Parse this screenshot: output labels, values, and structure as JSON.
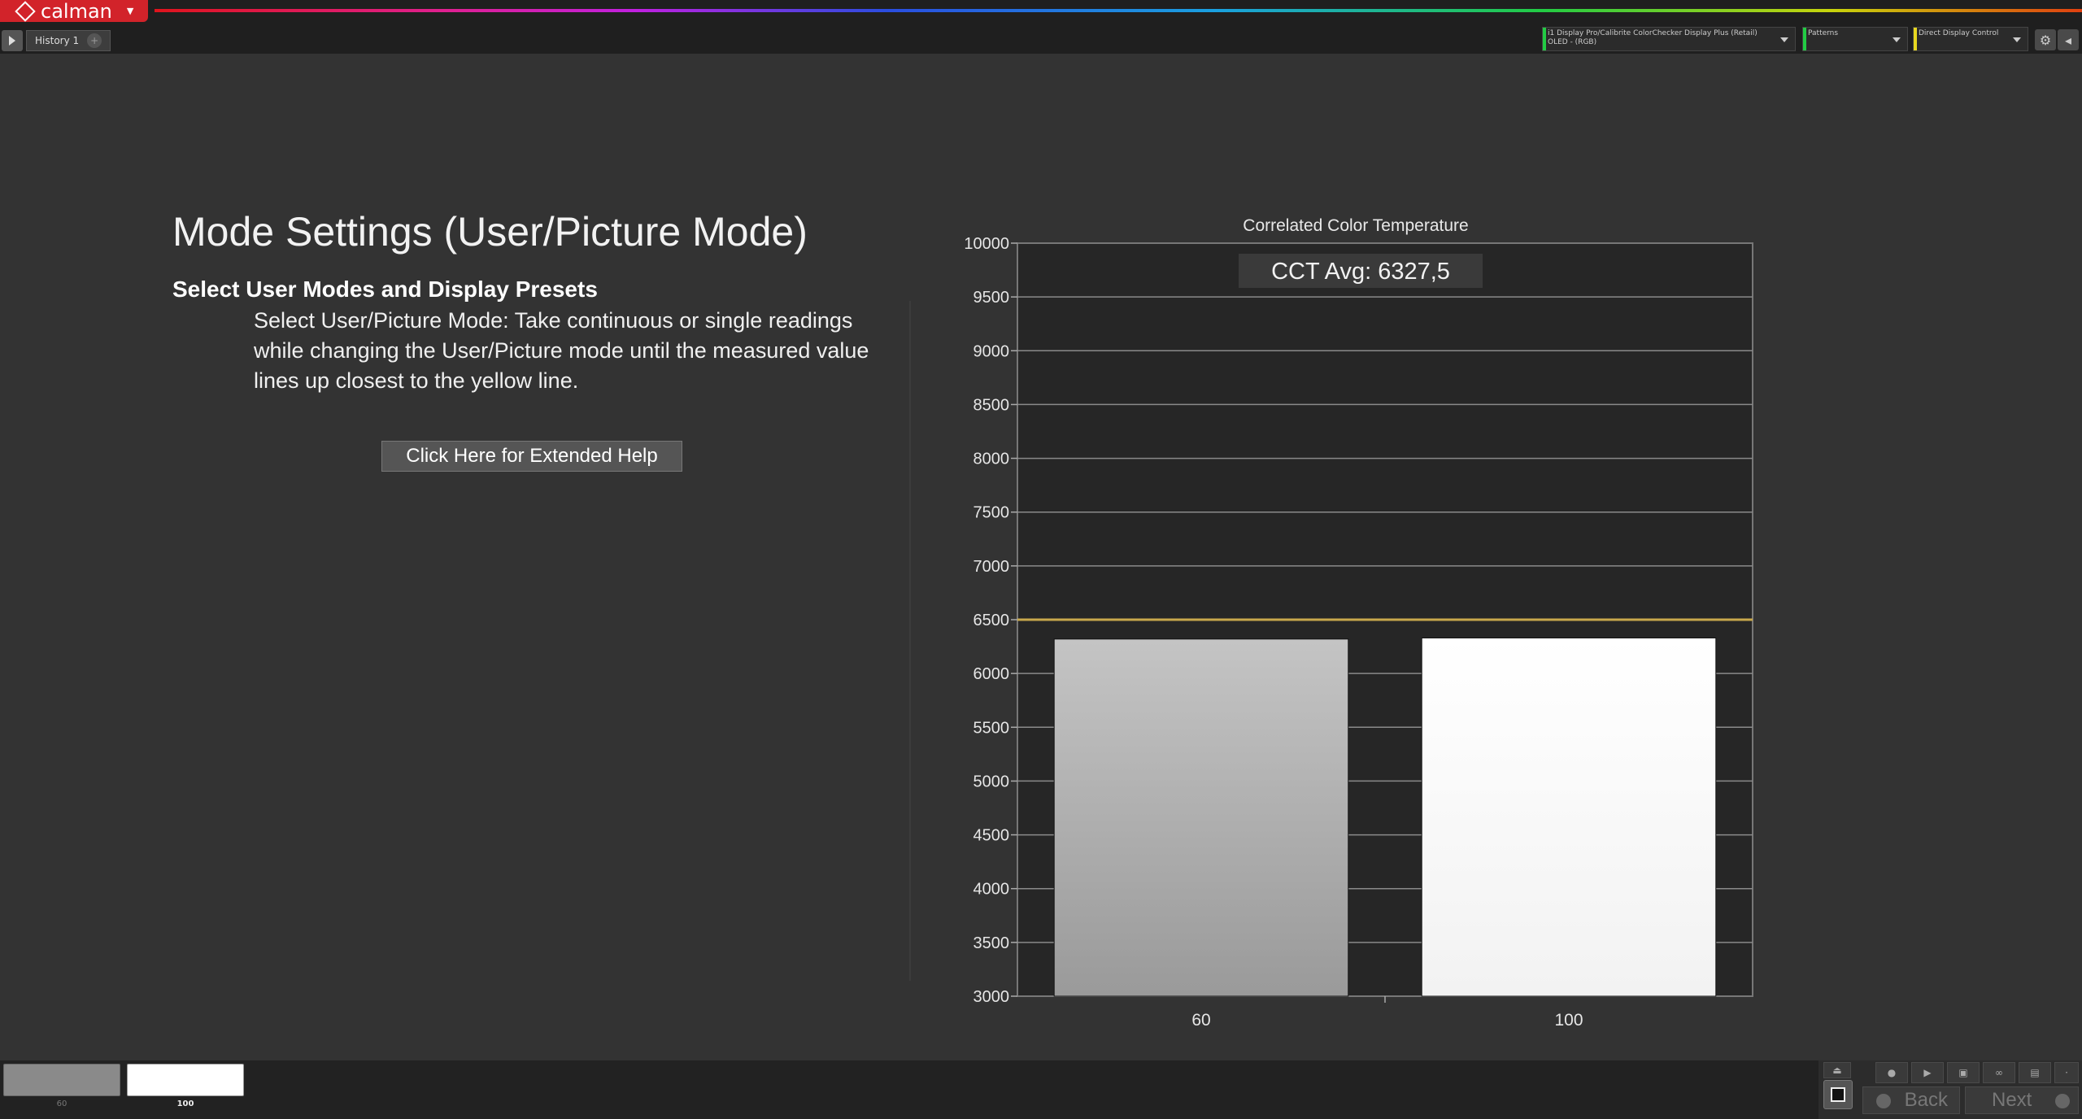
{
  "app": {
    "logo_text": "calman",
    "history_tab": "History 1"
  },
  "toolbar": {
    "meter": "i1 Display Pro/Calibrite ColorChecker Display Plus (Retail)",
    "meter_mode": "OLED - (RGB)",
    "patterns": "Patterns",
    "display_control": "Direct Display Control",
    "meter_color": "#22cc44",
    "patterns_color": "#22cc44",
    "control_color": "#e8d820"
  },
  "page": {
    "title": "Mode Settings (User/Picture Mode)",
    "subtitle": "Select User Modes and Display Presets",
    "description": "Select User/Picture Mode: Take continuous or single readings while changing the User/Picture mode until the measured value lines up closest to the yellow line.",
    "help_button": "Click Here for Extended Help"
  },
  "chart_data": {
    "type": "bar",
    "title": "Correlated Color Temperature",
    "annotation": "CCT Avg: 6327,5",
    "categories": [
      "60",
      "100"
    ],
    "values": [
      6320,
      6330
    ],
    "bar_colors": [
      "#9a9a9a",
      "#f2f2f2"
    ],
    "target_line": 6500,
    "target_color": "#c8a84c",
    "ylim": [
      3000,
      10000
    ],
    "yticks": [
      3000,
      3500,
      4000,
      4500,
      5000,
      5500,
      6000,
      6500,
      7000,
      7500,
      8000,
      8500,
      9000,
      9500,
      10000
    ],
    "grid": true
  },
  "bottom": {
    "thumb_60": "60",
    "thumb_100": "100",
    "back": "Back",
    "next": "Next"
  }
}
